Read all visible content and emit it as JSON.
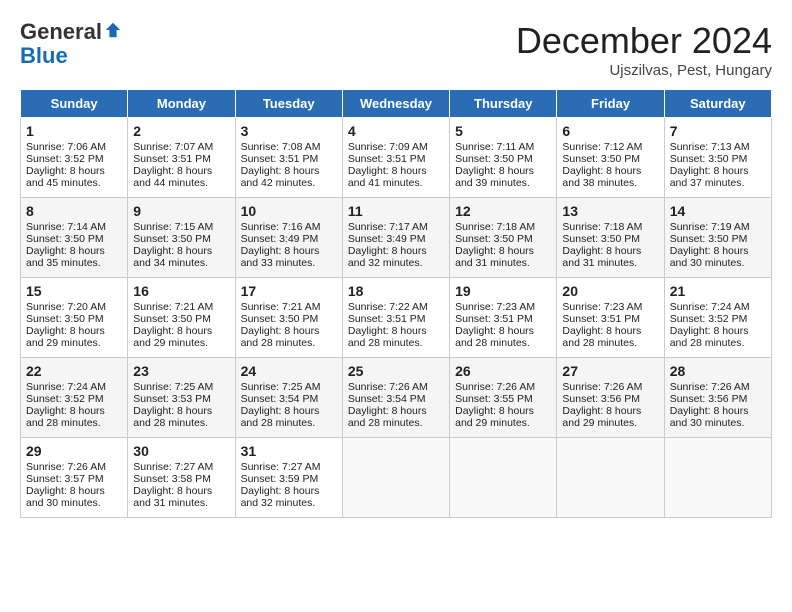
{
  "header": {
    "logo_general": "General",
    "logo_blue": "Blue",
    "month": "December 2024",
    "location": "Ujszilvas, Pest, Hungary"
  },
  "days_of_week": [
    "Sunday",
    "Monday",
    "Tuesday",
    "Wednesday",
    "Thursday",
    "Friday",
    "Saturday"
  ],
  "weeks": [
    [
      {
        "day": 1,
        "lines": [
          "Sunrise: 7:06 AM",
          "Sunset: 3:52 PM",
          "Daylight: 8 hours",
          "and 45 minutes."
        ]
      },
      {
        "day": 2,
        "lines": [
          "Sunrise: 7:07 AM",
          "Sunset: 3:51 PM",
          "Daylight: 8 hours",
          "and 44 minutes."
        ]
      },
      {
        "day": 3,
        "lines": [
          "Sunrise: 7:08 AM",
          "Sunset: 3:51 PM",
          "Daylight: 8 hours",
          "and 42 minutes."
        ]
      },
      {
        "day": 4,
        "lines": [
          "Sunrise: 7:09 AM",
          "Sunset: 3:51 PM",
          "Daylight: 8 hours",
          "and 41 minutes."
        ]
      },
      {
        "day": 5,
        "lines": [
          "Sunrise: 7:11 AM",
          "Sunset: 3:50 PM",
          "Daylight: 8 hours",
          "and 39 minutes."
        ]
      },
      {
        "day": 6,
        "lines": [
          "Sunrise: 7:12 AM",
          "Sunset: 3:50 PM",
          "Daylight: 8 hours",
          "and 38 minutes."
        ]
      },
      {
        "day": 7,
        "lines": [
          "Sunrise: 7:13 AM",
          "Sunset: 3:50 PM",
          "Daylight: 8 hours",
          "and 37 minutes."
        ]
      }
    ],
    [
      {
        "day": 8,
        "lines": [
          "Sunrise: 7:14 AM",
          "Sunset: 3:50 PM",
          "Daylight: 8 hours",
          "and 35 minutes."
        ]
      },
      {
        "day": 9,
        "lines": [
          "Sunrise: 7:15 AM",
          "Sunset: 3:50 PM",
          "Daylight: 8 hours",
          "and 34 minutes."
        ]
      },
      {
        "day": 10,
        "lines": [
          "Sunrise: 7:16 AM",
          "Sunset: 3:49 PM",
          "Daylight: 8 hours",
          "and 33 minutes."
        ]
      },
      {
        "day": 11,
        "lines": [
          "Sunrise: 7:17 AM",
          "Sunset: 3:49 PM",
          "Daylight: 8 hours",
          "and 32 minutes."
        ]
      },
      {
        "day": 12,
        "lines": [
          "Sunrise: 7:18 AM",
          "Sunset: 3:50 PM",
          "Daylight: 8 hours",
          "and 31 minutes."
        ]
      },
      {
        "day": 13,
        "lines": [
          "Sunrise: 7:18 AM",
          "Sunset: 3:50 PM",
          "Daylight: 8 hours",
          "and 31 minutes."
        ]
      },
      {
        "day": 14,
        "lines": [
          "Sunrise: 7:19 AM",
          "Sunset: 3:50 PM",
          "Daylight: 8 hours",
          "and 30 minutes."
        ]
      }
    ],
    [
      {
        "day": 15,
        "lines": [
          "Sunrise: 7:20 AM",
          "Sunset: 3:50 PM",
          "Daylight: 8 hours",
          "and 29 minutes."
        ]
      },
      {
        "day": 16,
        "lines": [
          "Sunrise: 7:21 AM",
          "Sunset: 3:50 PM",
          "Daylight: 8 hours",
          "and 29 minutes."
        ]
      },
      {
        "day": 17,
        "lines": [
          "Sunrise: 7:21 AM",
          "Sunset: 3:50 PM",
          "Daylight: 8 hours",
          "and 28 minutes."
        ]
      },
      {
        "day": 18,
        "lines": [
          "Sunrise: 7:22 AM",
          "Sunset: 3:51 PM",
          "Daylight: 8 hours",
          "and 28 minutes."
        ]
      },
      {
        "day": 19,
        "lines": [
          "Sunrise: 7:23 AM",
          "Sunset: 3:51 PM",
          "Daylight: 8 hours",
          "and 28 minutes."
        ]
      },
      {
        "day": 20,
        "lines": [
          "Sunrise: 7:23 AM",
          "Sunset: 3:51 PM",
          "Daylight: 8 hours",
          "and 28 minutes."
        ]
      },
      {
        "day": 21,
        "lines": [
          "Sunrise: 7:24 AM",
          "Sunset: 3:52 PM",
          "Daylight: 8 hours",
          "and 28 minutes."
        ]
      }
    ],
    [
      {
        "day": 22,
        "lines": [
          "Sunrise: 7:24 AM",
          "Sunset: 3:52 PM",
          "Daylight: 8 hours",
          "and 28 minutes."
        ]
      },
      {
        "day": 23,
        "lines": [
          "Sunrise: 7:25 AM",
          "Sunset: 3:53 PM",
          "Daylight: 8 hours",
          "and 28 minutes."
        ]
      },
      {
        "day": 24,
        "lines": [
          "Sunrise: 7:25 AM",
          "Sunset: 3:54 PM",
          "Daylight: 8 hours",
          "and 28 minutes."
        ]
      },
      {
        "day": 25,
        "lines": [
          "Sunrise: 7:26 AM",
          "Sunset: 3:54 PM",
          "Daylight: 8 hours",
          "and 28 minutes."
        ]
      },
      {
        "day": 26,
        "lines": [
          "Sunrise: 7:26 AM",
          "Sunset: 3:55 PM",
          "Daylight: 8 hours",
          "and 29 minutes."
        ]
      },
      {
        "day": 27,
        "lines": [
          "Sunrise: 7:26 AM",
          "Sunset: 3:56 PM",
          "Daylight: 8 hours",
          "and 29 minutes."
        ]
      },
      {
        "day": 28,
        "lines": [
          "Sunrise: 7:26 AM",
          "Sunset: 3:56 PM",
          "Daylight: 8 hours",
          "and 30 minutes."
        ]
      }
    ],
    [
      {
        "day": 29,
        "lines": [
          "Sunrise: 7:26 AM",
          "Sunset: 3:57 PM",
          "Daylight: 8 hours",
          "and 30 minutes."
        ]
      },
      {
        "day": 30,
        "lines": [
          "Sunrise: 7:27 AM",
          "Sunset: 3:58 PM",
          "Daylight: 8 hours",
          "and 31 minutes."
        ]
      },
      {
        "day": 31,
        "lines": [
          "Sunrise: 7:27 AM",
          "Sunset: 3:59 PM",
          "Daylight: 8 hours",
          "and 32 minutes."
        ]
      },
      null,
      null,
      null,
      null
    ]
  ]
}
